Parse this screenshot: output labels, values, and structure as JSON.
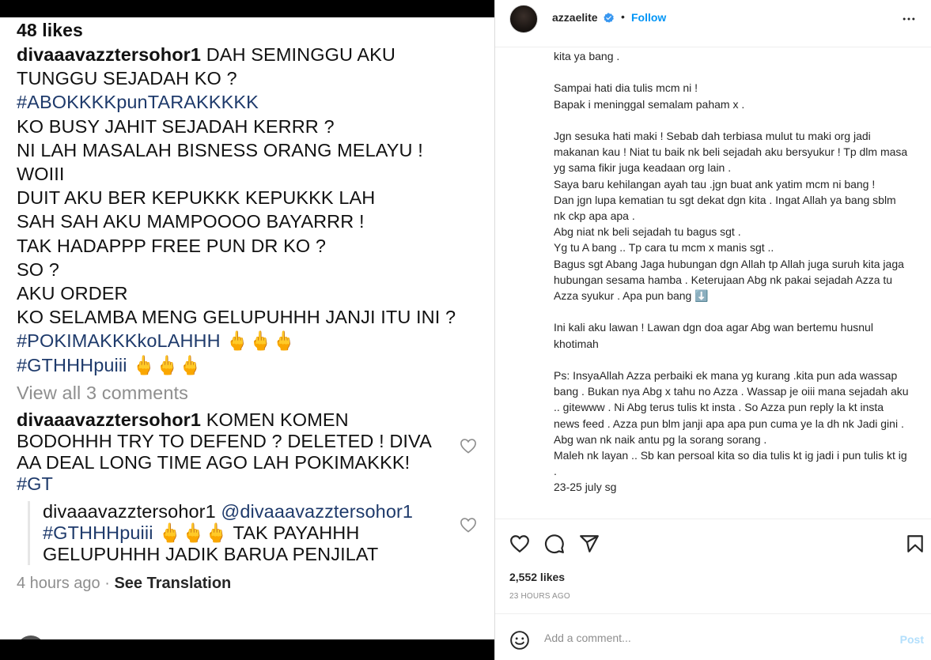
{
  "screenshot": {
    "likes": "48 likes",
    "caption": {
      "username": "divaaavazztersohor1",
      "line1_text": "DAH SEMINGGU AKU",
      "lines": [
        "TUNGGU SEJADAH KO ?"
      ],
      "tag1": "#ABOKKKKpunTARAKKKKK",
      "lines2": [
        "KO BUSY JAHIT SEJADAH KERRR ?",
        "NI LAH MASALAH BISNESS ORANG MELAYU !",
        "WOIII",
        "DUIT AKU BER KEPUKKK KEPUKKK LAH",
        "SAH SAH AKU MAMPOOOO BAYARRR !",
        "TAK HADAPPP FREE PUN DR KO ?",
        "SO ?",
        "AKU ORDER",
        "KO SELAMBA MENG GELUPUHHH JANJI ITU INI ?"
      ],
      "tag2": "#POKIMAKKKkoLAHHH",
      "tag2_emoji": "🖕🖕🖕",
      "tag3": "#GTHHHpuiii",
      "tag3_emoji": "🖕🖕🖕"
    },
    "view_all": "View all 3 comments",
    "comment": {
      "username": "divaaavazztersohor1",
      "text": "KOMEN KOMEN BODOHHH TRY TO DEFEND ? DELETED ! DIVA AA DEAL LONG TIME AGO LAH POKIMAKKK!",
      "tag": "#GT"
    },
    "reply": {
      "username": "divaaavazztersohor1",
      "mention": "@divaaavazztersohor1",
      "tag": "#GTHHHpuiii",
      "emoji": "🖕🖕🖕",
      "text": "TAK PAYAHHH GELUPUHHH JADIK BARUA PENJILAT"
    },
    "time": "4 hours ago",
    "separator": "·",
    "see_translation": "See Translation"
  },
  "post": {
    "username": "azzaelite",
    "dot": "•",
    "follow": "Follow",
    "caption": "kita ya bang .\n\nSampai hati dia tulis mcm ni !\nBapak i meninggal semalam paham x .\n\nJgn sesuka hati maki ! Sebab dah terbiasa mulut tu maki org jadi makanan kau ! Niat tu baik nk beli sejadah aku bersyukur ! Tp dlm masa yg sama fikir juga keadaan org lain .\nSaya baru kehilangan ayah tau .jgn buat ank yatim mcm ni bang !\nDan jgn lupa kematian tu sgt dekat dgn kita . Ingat Allah ya bang sblm nk ckp apa apa .\nAbg niat nk beli sejadah tu bagus sgt .\nYg tu A bang .. Tp cara tu mcm x manis sgt ..\nBagus sgt Abang Jaga hubungan dgn Allah tp Allah juga suruh kita jaga hubungan sesama hamba . Keterujaan Abg nk pakai sejadah Azza tu Azza syukur . Apa pun bang ⬇️\n\nIni kali aku lawan ! Lawan dgn doa agar Abg wan bertemu husnul khotimah\n\nPs: InsyaAllah Azza perbaiki ek mana yg kurang .kita pun ada wassap bang . Bukan nya Abg x tahu no Azza . Wassap je oiii mana sejadah aku .. gitewww . Ni Abg terus tulis kt insta . So Azza pun reply la kt insta news feed . Azza pun blm janji apa apa pun cuma ye la dh nk Jadi gini .\nAbg wan nk naik antu pg la sorang sorang .\nMaleh nk layan .. Sb kan persoal kita so dia tulis kt ig jadi i pun tulis kt ig .\n23-25 july sg",
    "likes": "2,552 likes",
    "time_ago": "23 HOURS AGO",
    "comment_placeholder": "Add a comment...",
    "post_label": "Post",
    "icons": {
      "like": "heart-icon",
      "comment": "comment-icon",
      "share": "share-icon",
      "save": "bookmark-icon",
      "more": "more-icon",
      "emoji": "emoji-icon",
      "verified": "verified-badge-icon"
    },
    "colors": {
      "follow": "#0095f6",
      "verified": "#3897f0",
      "post_disabled": "#b2dffc",
      "hashtag": "#1e3a6b"
    }
  }
}
